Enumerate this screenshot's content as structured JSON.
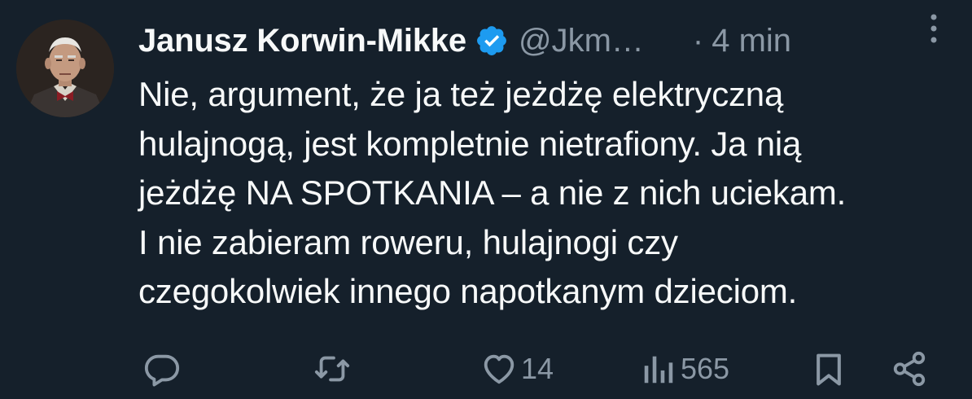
{
  "tweet": {
    "author": {
      "display_name": "Janusz Korwin-Mikke",
      "verified_icon": "verified-badge-icon",
      "handle": "@Jkm…",
      "separator": "·",
      "timestamp": "4 min"
    },
    "text_lines": [
      "Nie, argument, że ja też jeżdżę elektryczną",
      "hulajnogą, jest kompletnie nietrafiony. Ja nią",
      "jeżdżę NA SPOTKANIA – a nie z nich uciekam.",
      "I nie zabieram roweru, hulajnogi czy",
      "czegokolwiek innego napotkanym dzieciom."
    ],
    "actions": {
      "reply_icon": "reply-icon",
      "retweet_icon": "retweet-icon",
      "like_icon": "heart-icon",
      "like_count": "14",
      "views_icon": "views-chart-icon",
      "views_count": "565",
      "bookmark_icon": "bookmark-icon",
      "share_icon": "share-icon"
    }
  },
  "colors": {
    "background": "#15202b",
    "text": "#f7f9f9",
    "secondary": "#8b98a5",
    "verified": "#1d9bf0"
  }
}
